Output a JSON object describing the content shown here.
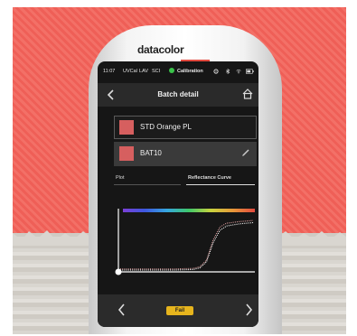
{
  "device": {
    "brand": "datacolor"
  },
  "status_bar": {
    "time": "11:07",
    "indicators": [
      "UVCal",
      "LAV",
      "SCI"
    ],
    "calibration_label": "Calibration",
    "icons": [
      "gear-icon",
      "bluetooth-icon",
      "wifi-icon",
      "battery-icon"
    ]
  },
  "header": {
    "title": "Batch detail",
    "back_icon": "chevron-left-icon",
    "home_icon": "home-icon"
  },
  "standard": {
    "name": "STD Orange PL",
    "color": "#d65f5f"
  },
  "batch": {
    "name": "BAT10",
    "color": "#d65f5f",
    "edit_icon": "pencil-icon"
  },
  "tabs": [
    {
      "label": "Plot",
      "active": false
    },
    {
      "label": "Reflectance Curve",
      "active": true
    }
  ],
  "chart_data": {
    "type": "line",
    "title": "",
    "xlabel": "",
    "ylabel": "",
    "grid": false,
    "x_range": [
      0,
      100
    ],
    "y_range": [
      0,
      100
    ],
    "series": [
      {
        "color": "#e0a0a0",
        "style": "dotted",
        "x": [
          0,
          20,
          40,
          55,
          60,
          65,
          70,
          75,
          80,
          90,
          100
        ],
        "y": [
          2,
          2,
          2,
          3,
          6,
          18,
          55,
          78,
          85,
          88,
          90
        ]
      },
      {
        "color": "#ffffff",
        "style": "dotted",
        "x": [
          0,
          20,
          40,
          55,
          60,
          65,
          70,
          75,
          80,
          90,
          100
        ],
        "y": [
          0,
          0,
          0,
          1,
          4,
          15,
          50,
          72,
          80,
          84,
          86
        ]
      }
    ],
    "spectrum_colors": [
      "#7b3fd6",
      "#3e58e0",
      "#36a7e0",
      "#3fc86a",
      "#c9d33e",
      "#e8983a",
      "#e24a3f"
    ]
  },
  "footer": {
    "prev_icon": "chevron-left-icon",
    "next_icon": "chevron-right-icon",
    "status": "Fail",
    "status_color": "#e6b41d"
  }
}
